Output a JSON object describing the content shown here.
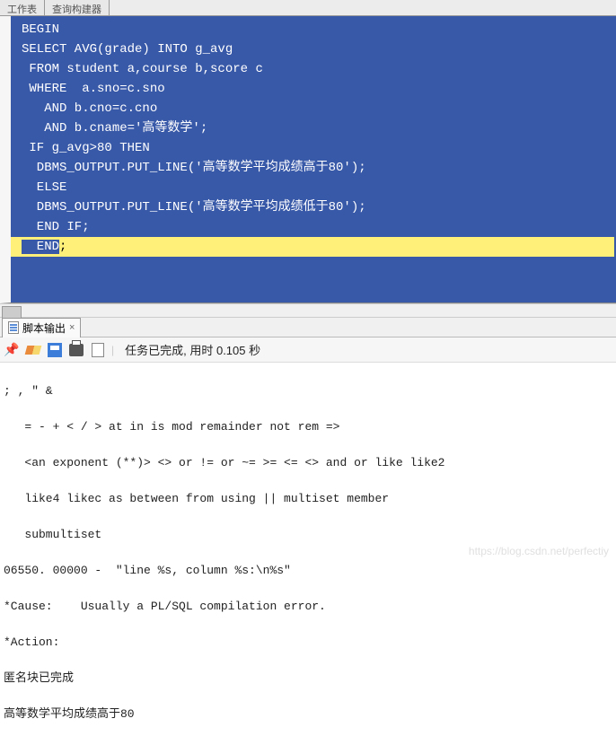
{
  "top_tabs": {
    "tab1": "工作表",
    "tab2": "查询构建器"
  },
  "code": {
    "selected_lines": [
      "BEGIN",
      "SELECT AVG(grade) INTO g_avg",
      " FROM student a,course b,score c",
      " WHERE  a.sno=c.sno",
      "   AND b.cno=c.cno",
      "   AND b.cname='高等数学';",
      " IF g_avg>80 THEN",
      "  DBMS_OUTPUT.PUT_LINE('高等数学平均成绩高于80');",
      "  ELSE",
      "  DBMS_OUTPUT.PUT_LINE('高等数学平均成绩低于80');",
      "  END IF;"
    ],
    "last_sel": "  END",
    "last_rest": ";"
  },
  "output_tab": {
    "label": "脚本输出",
    "close": "×"
  },
  "toolbar": {
    "status": "任务已完成, 用时 0.105 秒"
  },
  "output": {
    "l1": "; , \" &",
    "l2": "   = - + < / > at in is mod remainder not rem =>",
    "l3": "   <an exponent (**)> <> or != or ~= >= <= <> and or like like2",
    "l4": "   like4 likec as between from using || multiset member",
    "l5": "   submultiset",
    "l6": "06550. 00000 -  \"line %s, column %s:\\n%s\"",
    "l7": "*Cause:    Usually a PL/SQL compilation error.",
    "l8": "*Action:",
    "l9": "匿名块已完成",
    "l10": "高等数学平均成绩高于80"
  },
  "watermark": "https://blog.csdn.net/perfectiy"
}
